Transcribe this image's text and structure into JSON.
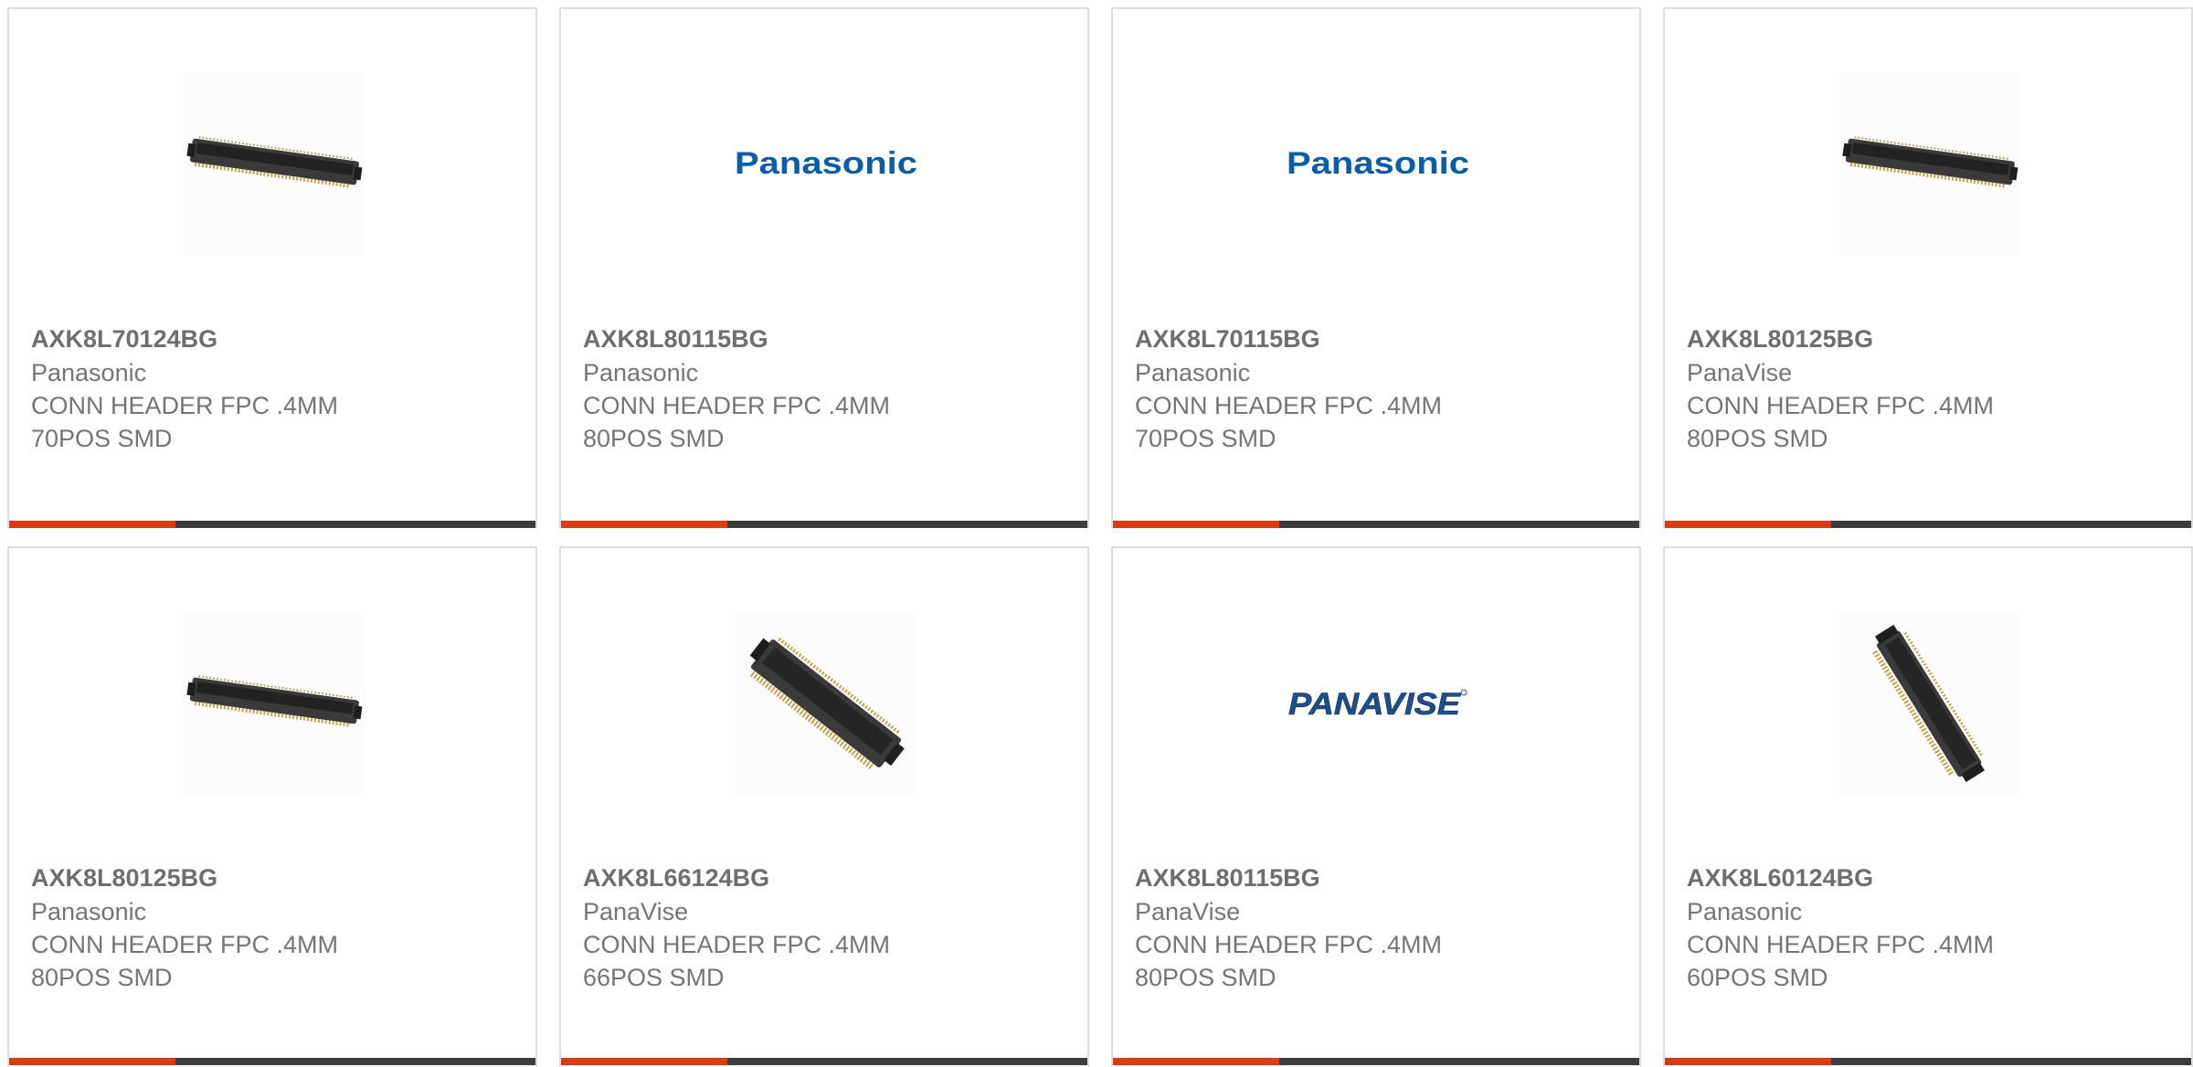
{
  "products": [
    {
      "part": "AXK8L70124BG",
      "manufacturer": "Panasonic",
      "description_line1": "CONN HEADER FPC .4MM",
      "description_line2": "70POS SMD",
      "image": "connector-horizontal-image"
    },
    {
      "part": "AXK8L80115BG",
      "manufacturer": "Panasonic",
      "description_line1": "CONN HEADER FPC .4MM",
      "description_line2": "80POS SMD",
      "image": "panasonic-logo",
      "logo_text": "Panasonic"
    },
    {
      "part": "AXK8L70115BG",
      "manufacturer": "Panasonic",
      "description_line1": "CONN HEADER FPC .4MM",
      "description_line2": "70POS SMD",
      "image": "panasonic-logo",
      "logo_text": "Panasonic"
    },
    {
      "part": "AXK8L80125BG",
      "manufacturer": "PanaVise",
      "description_line1": "CONN HEADER FPC .4MM",
      "description_line2": "80POS SMD",
      "image": "connector-horizontal-image"
    },
    {
      "part": "AXK8L80125BG",
      "manufacturer": "Panasonic",
      "description_line1": "CONN HEADER FPC .4MM",
      "description_line2": "80POS SMD",
      "image": "connector-horizontal-image"
    },
    {
      "part": "AXK8L66124BG",
      "manufacturer": "PanaVise",
      "description_line1": "CONN HEADER FPC .4MM",
      "description_line2": "66POS SMD",
      "image": "connector-diagonal-image"
    },
    {
      "part": "AXK8L80115BG",
      "manufacturer": "PanaVise",
      "description_line1": "CONN HEADER FPC .4MM",
      "description_line2": "80POS SMD",
      "image": "panavise-logo",
      "logo_text": "PANAVISE"
    },
    {
      "part": "AXK8L60124BG",
      "manufacturer": "Panasonic",
      "description_line1": "CONN HEADER FPC .4MM",
      "description_line2": "60POS SMD",
      "image": "connector-steep-image"
    }
  ],
  "colors": {
    "accent_bar": "#dc3a0f",
    "dark_bar": "#3d3d3d",
    "panasonic_blue": "#0a5ea8",
    "panavise_blue": "#1f4e8c"
  }
}
